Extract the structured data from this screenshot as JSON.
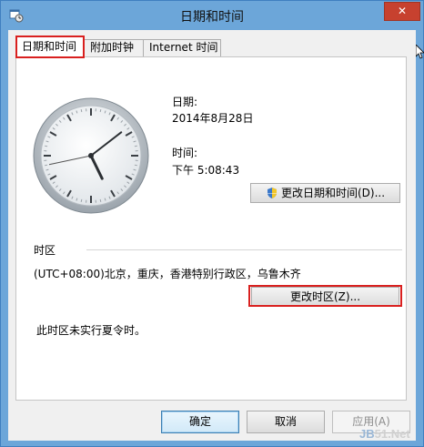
{
  "window": {
    "title": "日期和时间",
    "close_label": "✕"
  },
  "tabs": [
    {
      "label": "日期和时间",
      "active": true
    },
    {
      "label": "附加时钟",
      "active": false
    },
    {
      "label": "Internet 时间",
      "active": false
    }
  ],
  "datetime": {
    "date_label": "日期:",
    "date_value": "2014年8月28日",
    "time_label": "时间:",
    "time_value": "下午 5:08:43",
    "change_datetime_button": "更改日期和时间(D)..."
  },
  "clock": {
    "hour": 17,
    "minute": 8,
    "second": 43
  },
  "timezone": {
    "section_label": "时区",
    "value": "(UTC+08:00)北京，重庆，香港特别行政区，乌鲁木齐",
    "change_timezone_button": "更改时区(Z)...",
    "dst_note": "此时区未实行夏令时。"
  },
  "footer": {
    "ok_label": "确定",
    "cancel_label": "取消",
    "apply_label": "应用(A)"
  },
  "watermark": {
    "text_prefix": "JB",
    "text_rest": "51.Net"
  },
  "colors": {
    "highlight": "#d9201f",
    "close_button": "#c7412f",
    "titlebar": "#6ca6d9"
  }
}
